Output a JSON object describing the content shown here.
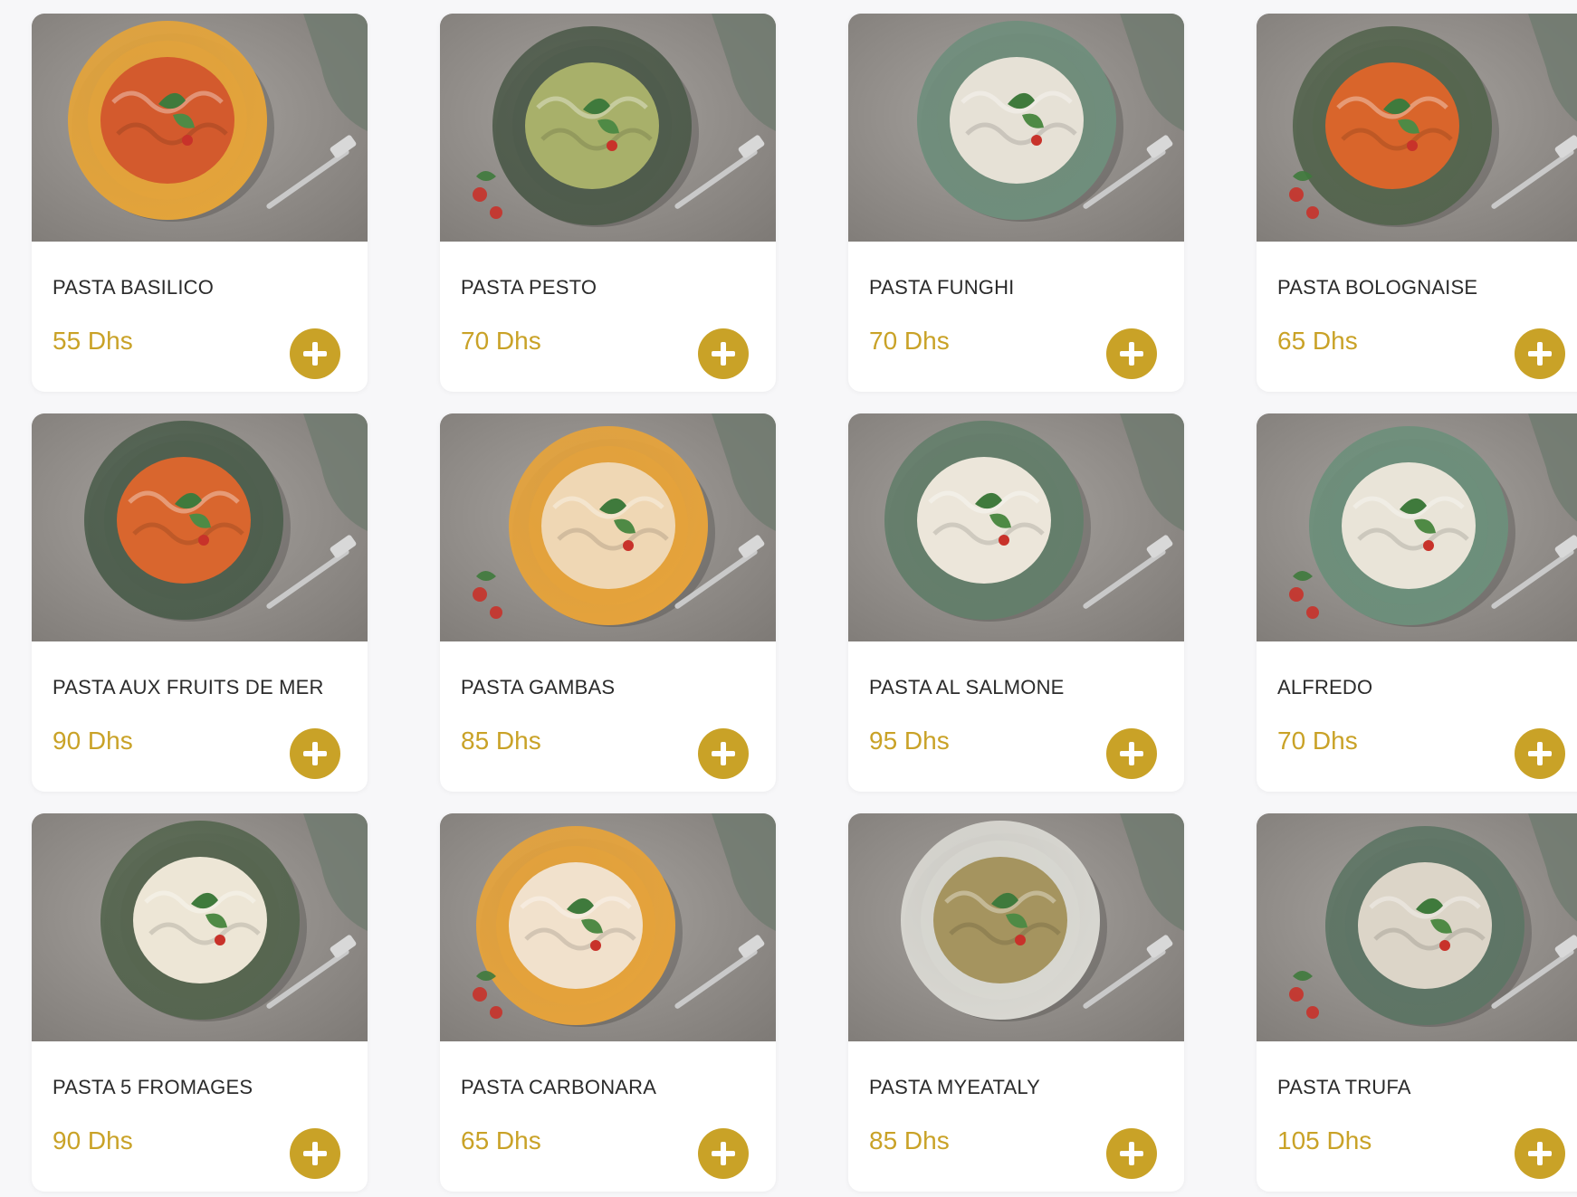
{
  "colors": {
    "accent": "#c9a227",
    "card_background": "#ffffff",
    "page_background": "#f7f7f9",
    "text": "#2b2b2b"
  },
  "icons": {
    "add": "plus-circle-icon"
  },
  "products": [
    {
      "name": "PASTA BASILICO",
      "price": "55 Dhs",
      "plate_color": "#e4a43a",
      "pasta_color": "#d35a2d"
    },
    {
      "name": "PASTA PESTO",
      "price": "70 Dhs",
      "plate_color": "#4f5c4c",
      "pasta_color": "#a8b06a"
    },
    {
      "name": "PASTA FUNGHI",
      "price": "70 Dhs",
      "plate_color": "#6f8e7c",
      "pasta_color": "#e6e1d6"
    },
    {
      "name": "PASTA BOLOGNAISE",
      "price": "65 Dhs",
      "plate_color": "#55654f",
      "pasta_color": "#d9652b"
    },
    {
      "name": "PASTA AUX FRUITS DE MER",
      "price": "90 Dhs",
      "plate_color": "#4e5f4e",
      "pasta_color": "#d9662e"
    },
    {
      "name": "PASTA GAMBAS",
      "price": "85 Dhs",
      "plate_color": "#e6a33b",
      "pasta_color": "#efd7b4"
    },
    {
      "name": "PASTA AL SALMONE",
      "price": "95 Dhs",
      "plate_color": "#647e6b",
      "pasta_color": "#ece6da"
    },
    {
      "name": "ALFREDO",
      "price": "70 Dhs",
      "plate_color": "#6d8f7b",
      "pasta_color": "#e9e4d8"
    },
    {
      "name": "PASTA 5 FROMAGES",
      "price": "90 Dhs",
      "plate_color": "#566650",
      "pasta_color": "#ede6d6"
    },
    {
      "name": "PASTA CARBONARA",
      "price": "65 Dhs",
      "plate_color": "#e6a33b",
      "pasta_color": "#f1e1cc"
    },
    {
      "name": "PASTA MYEATALY",
      "price": "85 Dhs",
      "plate_color": "#d9d8d2",
      "pasta_color": "#a5945f"
    },
    {
      "name": "PASTA TRUFA",
      "price": "105 Dhs",
      "plate_color": "#5e7565",
      "pasta_color": "#dcd5c8"
    }
  ]
}
